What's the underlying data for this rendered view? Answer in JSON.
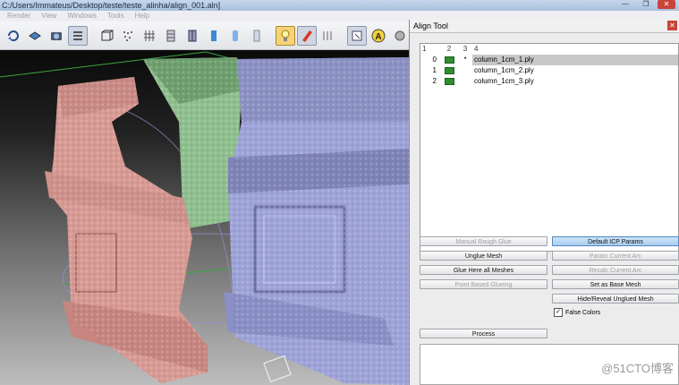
{
  "window": {
    "title": "C:/Users/Immateus/Desktop/teste/teste_alinha/align_001.aln]",
    "minimize": "—",
    "maximize": "❐",
    "close": "✕"
  },
  "menu": [
    "Render",
    "View",
    "Windows",
    "Tools",
    "Help"
  ],
  "toolbar_icons": [
    "rotate-icon",
    "layers-icon",
    "snapshot-icon",
    "stack-icon",
    "box-icon",
    "points-icon",
    "wireframe-icon",
    "hiddenlines-icon",
    "flatlines-icon",
    "flat-icon",
    "smooth-icon",
    "texture-icon",
    "light-icon",
    "color-icon",
    "lines-icon",
    "pick-icon",
    "align-icon",
    "paint-icon",
    "brush-icon",
    "pen-icon"
  ],
  "align_tool": {
    "title": "Align Tool",
    "columns": [
      "1",
      "2",
      "3",
      "4"
    ],
    "rows": [
      {
        "id": "0",
        "marker": "*",
        "name": "column_1cm_1.ply",
        "selected": true
      },
      {
        "id": "1",
        "marker": "",
        "name": "column_1cm_2.ply",
        "selected": false
      },
      {
        "id": "2",
        "marker": "",
        "name": "column_1cm_3.ply",
        "selected": false
      }
    ],
    "buttons": {
      "manual_rough_glue": "Manual Rough Glue",
      "default_icp_params": "Default ICP Params",
      "unglue_mesh": "Unglue Mesh",
      "param_current_arc": "Param Current Arc",
      "glue_here_all": "Glue Here all Meshes",
      "recalc_current_arc": "Recalc Current Arc",
      "point_based_glueing": "Point Based Glueing",
      "set_as_base_mesh": "Set as Base Mesh",
      "hide_reveal": "Hide/Reveal Unglued Mesh",
      "process": "Process"
    },
    "false_colors_label": "False Colors",
    "false_colors_checked": true
  },
  "watermark": "@51CTO博客",
  "colors": {
    "mesh1": "#d89a94",
    "mesh2": "#8fbf8f",
    "mesh3": "#9ea3d8"
  }
}
